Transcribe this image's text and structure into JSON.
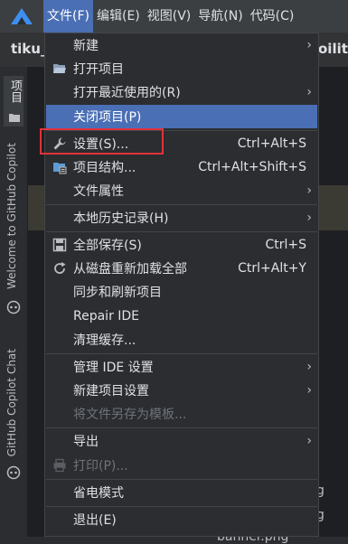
{
  "menubar": {
    "items": [
      "文件(F)",
      "编辑(E)",
      "视图(V)",
      "导航(N)",
      "代码(C)"
    ]
  },
  "toolbar": {
    "project_name": "tiku_",
    "right_text": "oility"
  },
  "side": {
    "project_label": "项目",
    "welcome_copilot": "Welcome to GitHub Copilot",
    "copilot_chat": "GitHub Copilot Chat"
  },
  "background": {
    "frag1": "g",
    "frag2": "g",
    "frag3": "banner.png"
  },
  "file_menu": {
    "items": {
      "new": {
        "label": "新建"
      },
      "open_project": {
        "label": "打开项目"
      },
      "open_recent": {
        "label": "打开最近使用的(R)"
      },
      "close_project": {
        "label": "关闭项目(P)"
      },
      "settings": {
        "label": "设置(S)...",
        "shortcut": "Ctrl+Alt+S"
      },
      "project_structure": {
        "label": "项目结构...",
        "shortcut": "Ctrl+Alt+Shift+S"
      },
      "file_properties": {
        "label": "文件属性"
      },
      "local_history": {
        "label": "本地历史记录(H)"
      },
      "save_all": {
        "label": "全部保存(S)",
        "shortcut": "Ctrl+S"
      },
      "reload_all": {
        "label": "从磁盘重新加载全部",
        "shortcut": "Ctrl+Alt+Y"
      },
      "sync_refresh": {
        "label": "同步和刷新项目"
      },
      "repair_ide": {
        "label": "Repair IDE"
      },
      "clear_cache": {
        "label": "清理缓存..."
      },
      "manage_ide_settings": {
        "label": "管理 IDE 设置"
      },
      "new_project_settings": {
        "label": "新建项目设置"
      },
      "save_as_template": {
        "label": "将文件另存为模板..."
      },
      "export": {
        "label": "导出"
      },
      "print": {
        "label": "打印(P)..."
      },
      "power_save": {
        "label": "省电模式"
      },
      "exit": {
        "label": "退出(E)"
      }
    }
  },
  "colors": {
    "highlight": "#4a6fb5",
    "annotation_box": "#e2323b",
    "folder_icon": "#5d9bd5"
  }
}
